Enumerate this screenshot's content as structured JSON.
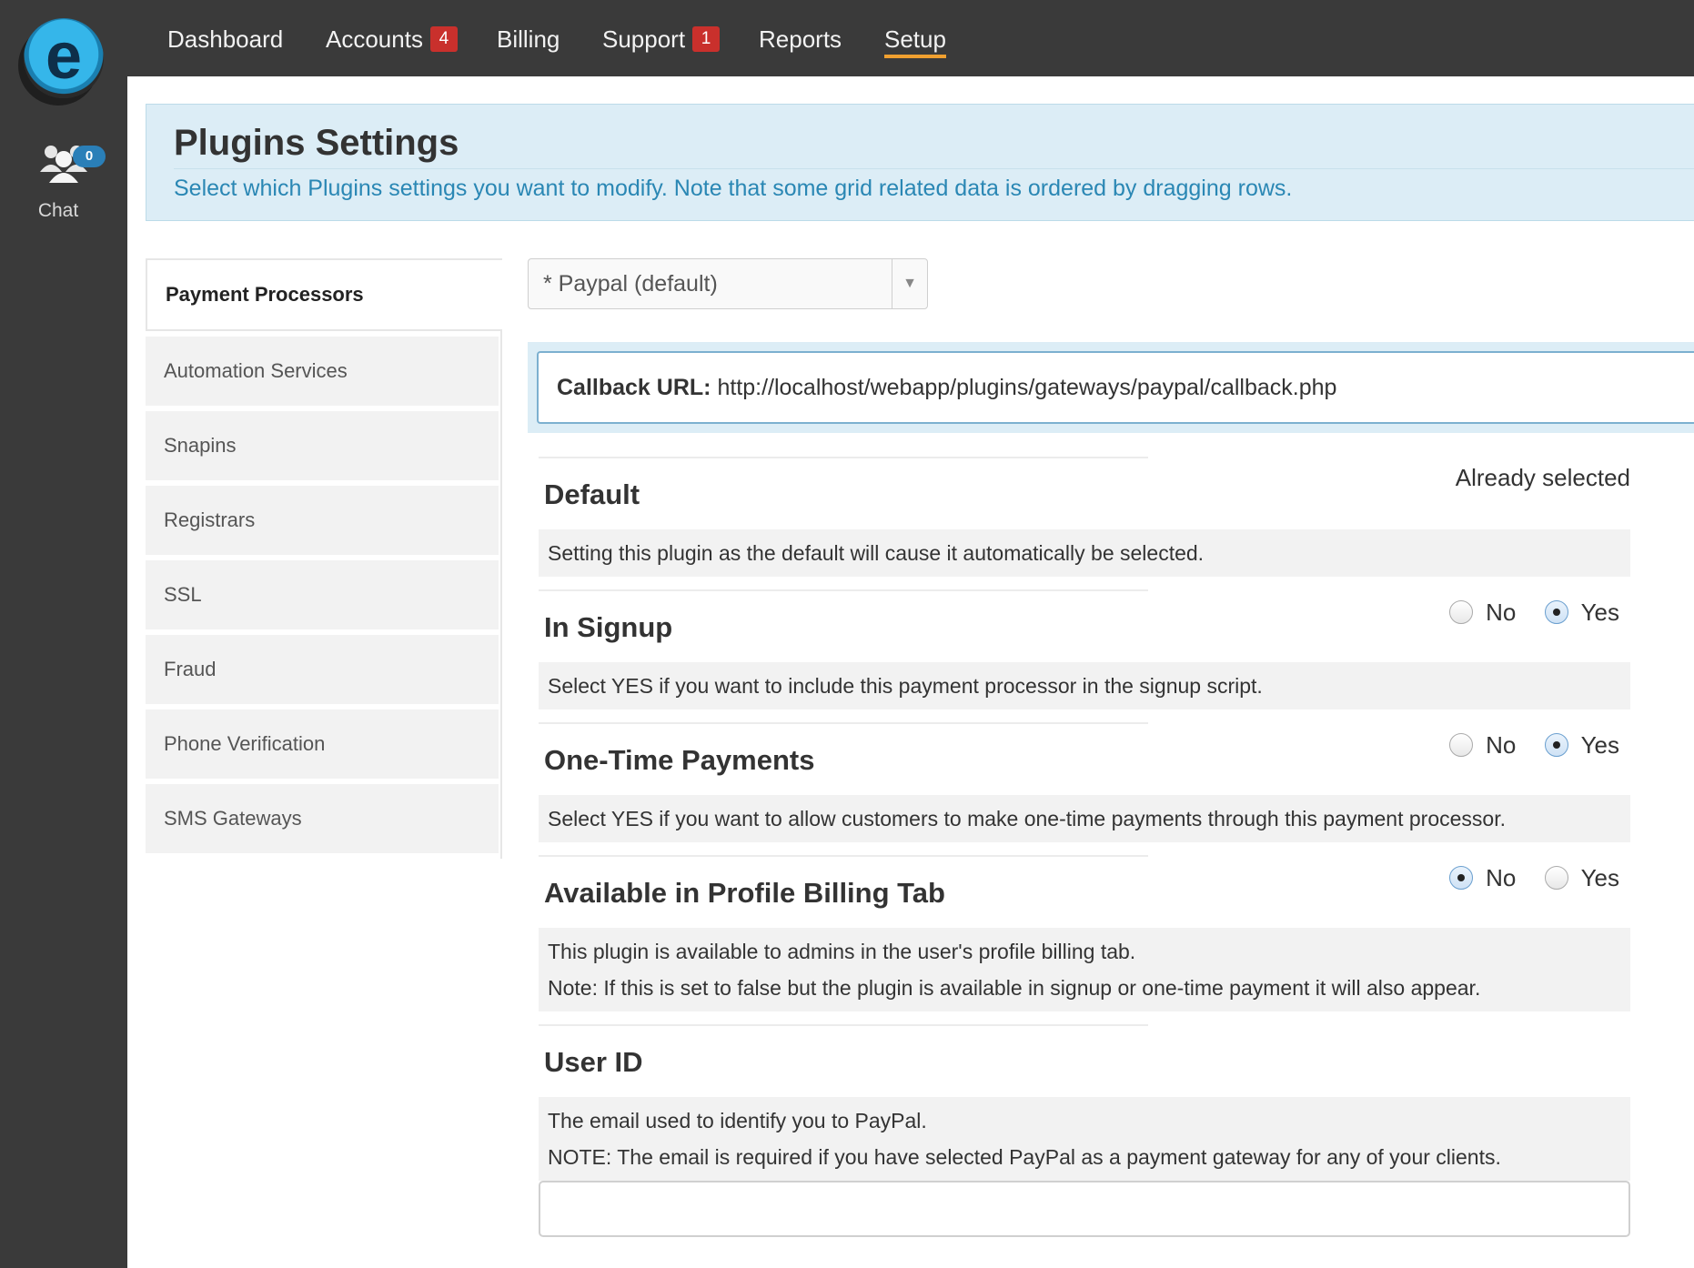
{
  "rail": {
    "chat_badge": "0",
    "chat_label": "Chat"
  },
  "nav": {
    "items": [
      {
        "label": "Dashboard"
      },
      {
        "label": "Accounts",
        "badge": "4"
      },
      {
        "label": "Billing"
      },
      {
        "label": "Support",
        "badge": "1"
      },
      {
        "label": "Reports"
      },
      {
        "label": "Setup",
        "active": true
      }
    ]
  },
  "header": {
    "title": "Plugins Settings",
    "subtitle": "Select which Plugins settings you want to modify. Note that some grid related data is ordered by dragging rows."
  },
  "sidebar": {
    "items": [
      {
        "label": "Payment Processors",
        "active": true
      },
      {
        "label": "Automation Services"
      },
      {
        "label": "Snapins"
      },
      {
        "label": "Registrars"
      },
      {
        "label": "SSL"
      },
      {
        "label": "Fraud"
      },
      {
        "label": "Phone Verification"
      },
      {
        "label": "SMS Gateways"
      }
    ]
  },
  "processor_select": {
    "value": "* Paypal (default)"
  },
  "callback": {
    "label": "Callback URL:",
    "url": "http://localhost/webapp/plugins/gateways/paypal/callback.php"
  },
  "settings": {
    "default": {
      "title": "Default",
      "status": "Already selected",
      "description": "Setting this plugin as the default will cause it automatically be selected."
    },
    "in_signup": {
      "title": "In Signup",
      "no_label": "No",
      "yes_label": "Yes",
      "selected": "Yes",
      "description": "Select YES if you want to include this payment processor in the signup script."
    },
    "one_time": {
      "title": "One-Time Payments",
      "no_label": "No",
      "yes_label": "Yes",
      "selected": "Yes",
      "description": "Select YES if you want to allow customers to make one-time payments through this payment processor."
    },
    "profile_billing": {
      "title": "Available in Profile Billing Tab",
      "no_label": "No",
      "yes_label": "Yes",
      "selected": "No",
      "description_1": "This plugin is available to admins in the user's profile billing tab.",
      "description_2": "Note: If this is set to false but the plugin is available in signup or one-time payment it will also appear."
    },
    "user_id": {
      "title": "User ID",
      "description_1": "The email used to identify you to PayPal.",
      "description_2": "NOTE: The email is required if you have selected PayPal as a payment gateway for any of your clients.",
      "value": ""
    }
  },
  "colors": {
    "nav_bg": "#3a3a3a",
    "accent_underline": "#f0a030",
    "badge_red": "#c9302c",
    "header_bg": "#dcedf6",
    "subtitle_blue": "#2a87b4"
  }
}
